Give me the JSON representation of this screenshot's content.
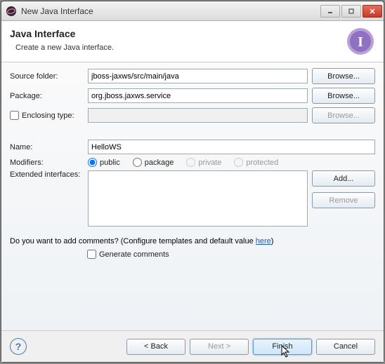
{
  "window": {
    "title": "New Java Interface"
  },
  "header": {
    "title": "Java Interface",
    "subtitle": "Create a new Java interface."
  },
  "form": {
    "source_folder_label": "Source folder:",
    "source_folder_value": "jboss-jaxws/src/main/java",
    "package_label": "Package:",
    "package_value": "org.jboss.jaxws.service",
    "enclosing_label": "Enclosing type:",
    "enclosing_value": "",
    "name_label": "Name:",
    "name_value": "HelloWS",
    "modifiers_label": "Modifiers:",
    "modifiers": {
      "public": "public",
      "package": "package",
      "private": "private",
      "protected": "protected"
    },
    "extended_label": "Extended interfaces:",
    "browse": "Browse...",
    "add": "Add...",
    "remove": "Remove"
  },
  "comments": {
    "question": "Do you want to add comments? (Configure templates and default value ",
    "link": "here",
    "closing": ")",
    "generate": "Generate comments"
  },
  "footer": {
    "back": "< Back",
    "next": "Next >",
    "finish": "Finish",
    "cancel": "Cancel"
  }
}
